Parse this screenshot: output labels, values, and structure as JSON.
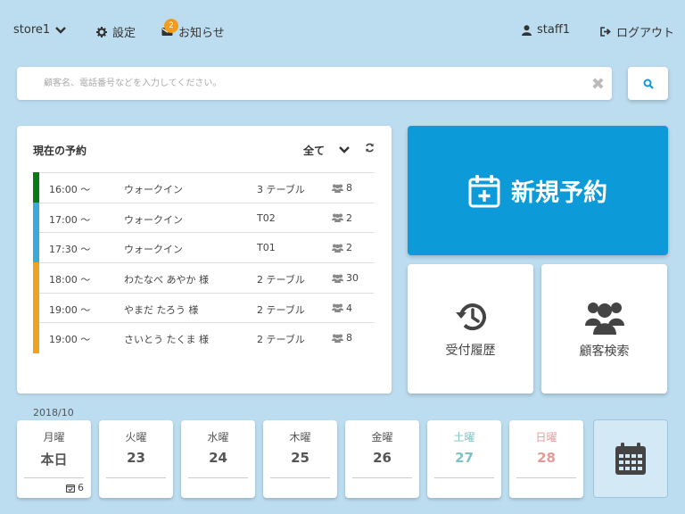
{
  "header": {
    "store": "store1",
    "settings": "設定",
    "notifications": "お知らせ",
    "notification_count": "2",
    "user": "staff1",
    "logout": "ログアウト"
  },
  "search": {
    "placeholder": "顧客名、電話番号などを入力してください。"
  },
  "reservations": {
    "title": "現在の予約",
    "filter": "全て",
    "rows": [
      {
        "time": "16:00 〜",
        "name": "ウォークイン",
        "table": "3 テーブル",
        "guests": "8",
        "color": "#0a7a12"
      },
      {
        "time": "17:00 〜",
        "name": "ウォークイン",
        "table": "T02",
        "guests": "2",
        "color": "#3aa9de"
      },
      {
        "time": "17:30 〜",
        "name": "ウォークイン",
        "table": "T01",
        "guests": "2",
        "color": "#3aa9de"
      },
      {
        "time": "18:00 〜",
        "name": "わたなべ あやか 様",
        "table": "2 テーブル",
        "guests": "30",
        "color": "#f0a124"
      },
      {
        "time": "19:00 〜",
        "name": "やまだ たろう 様",
        "table": "2 テーブル",
        "guests": "4",
        "color": "#f0a124"
      },
      {
        "time": "19:00 〜",
        "name": "さいとう たくま 様",
        "table": "2 テーブル",
        "guests": "8",
        "color": "#f0a124"
      }
    ]
  },
  "actions": {
    "new_reservation": "新規予約",
    "history": "受付履歴",
    "customer_search": "顧客検索"
  },
  "calendar": {
    "month": "2018/10",
    "days": [
      {
        "name": "月曜",
        "date": "本日",
        "count": "6",
        "color": "#555555"
      },
      {
        "name": "火曜",
        "date": "23",
        "count": "",
        "color": "#555555"
      },
      {
        "name": "水曜",
        "date": "24",
        "count": "",
        "color": "#555555"
      },
      {
        "name": "木曜",
        "date": "25",
        "count": "",
        "color": "#555555"
      },
      {
        "name": "金曜",
        "date": "26",
        "count": "",
        "color": "#555555"
      },
      {
        "name": "土曜",
        "date": "27",
        "count": "",
        "color": "#7cc3c4"
      },
      {
        "name": "日曜",
        "date": "28",
        "count": "",
        "color": "#e59a9a"
      }
    ]
  },
  "colors": {
    "accent": "#0c9bd8",
    "background": "#bcdcef"
  }
}
